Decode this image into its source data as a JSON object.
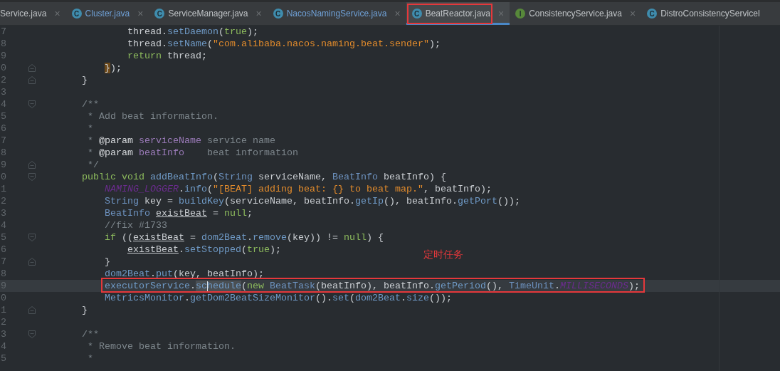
{
  "tabs": [
    {
      "label": "Service.java",
      "close": "×",
      "modified": false,
      "selected": false,
      "boxed": false
    },
    {
      "label": "Cluster.java",
      "badge": "C",
      "color": "#3f8cad",
      "close": "×",
      "modified": true,
      "selected": false,
      "boxed": false
    },
    {
      "label": "ServiceManager.java",
      "badge": "C",
      "color": "#3f8cad",
      "close": "×",
      "modified": false,
      "selected": false,
      "boxed": false
    },
    {
      "label": "NacosNamingService.java",
      "badge": "C",
      "color": "#3f8cad",
      "close": "×",
      "modified": true,
      "selected": false,
      "boxed": false
    },
    {
      "label": "BeatReactor.java",
      "badge": "C",
      "color": "#3f8cad",
      "close": "×",
      "modified": false,
      "selected": true,
      "boxed": true
    },
    {
      "label": "ConsistencyService.java",
      "badge": "I",
      "color": "#57883a",
      "close": "×",
      "modified": false,
      "selected": false,
      "boxed": false
    },
    {
      "label": "DistroConsistencyServiceI",
      "badge": "C",
      "color": "#3f8cad",
      "modified": false,
      "selected": false,
      "boxed": false
    }
  ],
  "editor": {
    "lines": [
      {
        "num": "7",
        "tokens": [
          {
            "kind": "plain",
            "t": "                thread."
          },
          {
            "kind": "method",
            "t": "setDaemon"
          },
          {
            "kind": "plain",
            "t": "("
          },
          {
            "kind": "keyword",
            "t": "true"
          },
          {
            "kind": "plain",
            "t": ");"
          }
        ]
      },
      {
        "num": "8",
        "tokens": [
          {
            "kind": "plain",
            "t": "                thread."
          },
          {
            "kind": "method",
            "t": "setName"
          },
          {
            "kind": "plain",
            "t": "("
          },
          {
            "kind": "string",
            "t": "\"com.alibaba.nacos.naming.beat.sender\""
          },
          {
            "kind": "plain",
            "t": ");"
          }
        ]
      },
      {
        "num": "9",
        "tokens": [
          {
            "kind": "keyword",
            "t": "                return"
          },
          {
            "kind": "plain",
            "t": " thread;"
          }
        ]
      },
      {
        "num": "0",
        "fold": {
          "kind": "end"
        },
        "tokens": [
          {
            "kind": "bracket",
            "t": "            }"
          },
          {
            "kind": "plain",
            "t": ");"
          }
        ]
      },
      {
        "num": "2",
        "fold": {
          "kind": "end"
        },
        "tokens": [
          {
            "kind": "plain",
            "t": "        }"
          }
        ]
      },
      {
        "num": "3"
      },
      {
        "num": "4",
        "fold": {
          "kind": "start"
        },
        "tokens": [
          {
            "kind": "comment",
            "t": "        /**"
          }
        ]
      },
      {
        "num": "5",
        "tokens": [
          {
            "kind": "comment",
            "t": "         * Add beat information."
          }
        ]
      },
      {
        "num": "6",
        "tokens": [
          {
            "kind": "comment",
            "t": "         *"
          }
        ]
      },
      {
        "num": "7",
        "tokens": [
          {
            "kind": "comment",
            "t": "         * "
          },
          {
            "kind": "doctag",
            "t": "@param "
          },
          {
            "kind": "docparam",
            "t": "serviceName"
          },
          {
            "kind": "comment",
            "t": " service name"
          }
        ]
      },
      {
        "num": "8",
        "tokens": [
          {
            "kind": "comment",
            "t": "         * "
          },
          {
            "kind": "doctag",
            "t": "@param "
          },
          {
            "kind": "docparam",
            "t": "beatInfo"
          },
          {
            "kind": "comment",
            "t": "    beat information"
          }
        ]
      },
      {
        "num": "9",
        "fold": {
          "kind": "end"
        },
        "tokens": [
          {
            "kind": "comment",
            "t": "         */"
          }
        ]
      },
      {
        "num": "0",
        "fold": {
          "kind": "start"
        },
        "tokens": [
          {
            "kind": "keyword",
            "t": "        public void "
          },
          {
            "kind": "method",
            "t": "addBeatInfo"
          },
          {
            "kind": "plain",
            "t": "("
          },
          {
            "kind": "type",
            "t": "String"
          },
          {
            "kind": "plain",
            "t": " serviceName, "
          },
          {
            "kind": "type",
            "t": "BeatInfo"
          },
          {
            "kind": "plain",
            "t": " beatInfo) {"
          }
        ]
      },
      {
        "num": "1",
        "tokens": [
          {
            "kind": "static",
            "t": "            NAMING_LOGGER"
          },
          {
            "kind": "plain",
            "t": "."
          },
          {
            "kind": "method",
            "t": "info"
          },
          {
            "kind": "plain",
            "t": "("
          },
          {
            "kind": "string",
            "t": "\"[BEAT] adding beat: {} to beat map.\""
          },
          {
            "kind": "plain",
            "t": ", beatInfo);"
          }
        ]
      },
      {
        "num": "2",
        "tokens": [
          {
            "kind": "type",
            "t": "            String"
          },
          {
            "kind": "plain",
            "t": " key = "
          },
          {
            "kind": "method",
            "t": "buildKey"
          },
          {
            "kind": "plain",
            "t": "(serviceName, beatInfo."
          },
          {
            "kind": "method",
            "t": "getIp"
          },
          {
            "kind": "plain",
            "t": "(), beatInfo."
          },
          {
            "kind": "method",
            "t": "getPort"
          },
          {
            "kind": "plain",
            "t": "());"
          }
        ]
      },
      {
        "num": "3",
        "tokens": [
          {
            "kind": "type",
            "t": "            BeatInfo "
          },
          {
            "kind": "variable",
            "t": "existBeat"
          },
          {
            "kind": "plain",
            "t": " = "
          },
          {
            "kind": "keyword",
            "t": "null"
          },
          {
            "kind": "plain",
            "t": ";"
          }
        ]
      },
      {
        "num": "4",
        "tokens": [
          {
            "kind": "comment",
            "t": "            //fix #1733"
          }
        ]
      },
      {
        "num": "5",
        "fold": {
          "kind": "start"
        },
        "tokens": [
          {
            "kind": "keyword",
            "t": "            if"
          },
          {
            "kind": "plain",
            "t": " (("
          },
          {
            "kind": "variable",
            "t": "existBeat"
          },
          {
            "kind": "plain",
            "t": " = "
          },
          {
            "kind": "method",
            "t": "dom2Beat"
          },
          {
            "kind": "plain",
            "t": "."
          },
          {
            "kind": "method",
            "t": "remove"
          },
          {
            "kind": "plain",
            "t": "(key)) != "
          },
          {
            "kind": "keyword",
            "t": "null"
          },
          {
            "kind": "plain",
            "t": ") {"
          }
        ]
      },
      {
        "num": "6",
        "tokens": [
          {
            "kind": "variable",
            "t": "                existBeat"
          },
          {
            "kind": "plain",
            "t": "."
          },
          {
            "kind": "method",
            "t": "setStopped"
          },
          {
            "kind": "plain",
            "t": "("
          },
          {
            "kind": "keyword",
            "t": "true"
          },
          {
            "kind": "plain",
            "t": ");"
          }
        ]
      },
      {
        "num": "7",
        "fold": {
          "kind": "end"
        },
        "tokens": [
          {
            "kind": "plain",
            "t": "            }"
          }
        ]
      },
      {
        "num": "8",
        "tokens": [
          {
            "kind": "method",
            "t": "            dom2Beat"
          },
          {
            "kind": "plain",
            "t": "."
          },
          {
            "kind": "method",
            "t": "put"
          },
          {
            "kind": "plain",
            "t": "(key, beatInfo);"
          }
        ]
      },
      {
        "num": "9",
        "current": true,
        "boxed": true,
        "tokens": [
          {
            "kind": "method",
            "t": "            executorService"
          },
          {
            "kind": "plain",
            "t": "."
          },
          {
            "kind": "occurrence",
            "t": "schedule"
          },
          {
            "kind": "plain",
            "t": "("
          },
          {
            "kind": "keyword",
            "t": "new "
          },
          {
            "kind": "type",
            "t": "BeatTask"
          },
          {
            "kind": "plain",
            "t": "(beatInfo), beatInfo."
          },
          {
            "kind": "method",
            "t": "getPeriod"
          },
          {
            "kind": "plain",
            "t": "(), "
          },
          {
            "kind": "type",
            "t": "TimeUnit"
          },
          {
            "kind": "plain",
            "t": "."
          },
          {
            "kind": "static",
            "t": "MILLISECONDS"
          },
          {
            "kind": "plain",
            "t": ");"
          }
        ]
      },
      {
        "num": "0",
        "tokens": [
          {
            "kind": "method",
            "t": "            MetricsMonitor"
          },
          {
            "kind": "plain",
            "t": "."
          },
          {
            "kind": "method",
            "t": "getDom2BeatSizeMonitor"
          },
          {
            "kind": "plain",
            "t": "()."
          },
          {
            "kind": "method",
            "t": "set"
          },
          {
            "kind": "plain",
            "t": "("
          },
          {
            "kind": "method",
            "t": "dom2Beat"
          },
          {
            "kind": "plain",
            "t": "."
          },
          {
            "kind": "method",
            "t": "size"
          },
          {
            "kind": "plain",
            "t": "());"
          }
        ]
      },
      {
        "num": "1",
        "fold": {
          "kind": "end"
        },
        "tokens": [
          {
            "kind": "plain",
            "t": "        }"
          }
        ]
      },
      {
        "num": "2"
      },
      {
        "num": "3",
        "fold": {
          "kind": "start"
        },
        "tokens": [
          {
            "kind": "comment",
            "t": "        /**"
          }
        ]
      },
      {
        "num": "4",
        "tokens": [
          {
            "kind": "comment",
            "t": "         * Remove beat information."
          }
        ]
      },
      {
        "num": "5",
        "tokens": [
          {
            "kind": "comment",
            "t": "         *"
          }
        ]
      }
    ]
  },
  "annotations": [
    {
      "kind": "note",
      "text": "定时任务"
    }
  ]
}
